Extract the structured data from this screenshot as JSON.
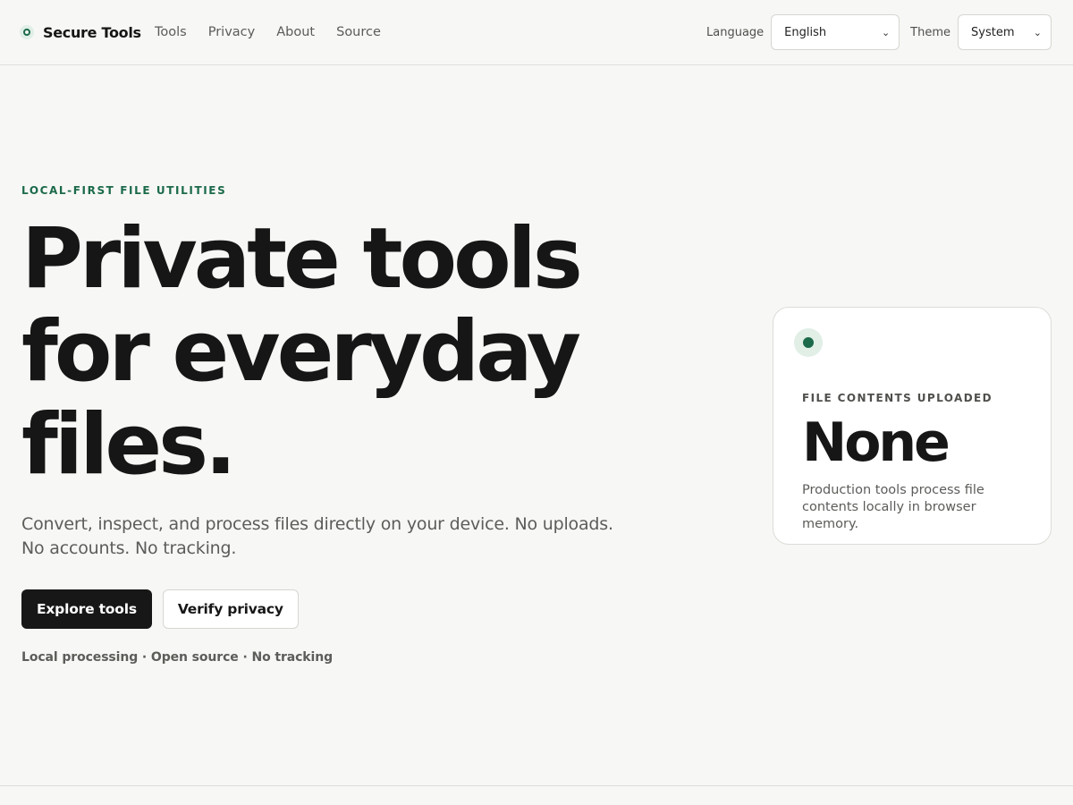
{
  "header": {
    "brand": "Secure Tools",
    "nav": [
      {
        "label": "Tools"
      },
      {
        "label": "Privacy"
      },
      {
        "label": "About"
      },
      {
        "label": "Source"
      }
    ],
    "language": {
      "label": "Language",
      "value": "English"
    },
    "theme": {
      "label": "Theme",
      "value": "System"
    }
  },
  "hero": {
    "eyebrow": "LOCAL-FIRST FILE UTILITIES",
    "title_lines": [
      "Private tools",
      "for everyday",
      "files."
    ],
    "subtitle": "Convert, inspect, and process files directly on your device. No uploads. No accounts. No tracking.",
    "primary_cta": "Explore tools",
    "secondary_cta": "Verify privacy",
    "meta": "Local processing · Open source · No tracking"
  },
  "card": {
    "icon": "status-dot-icon",
    "label": "FILE CONTENTS UPLOADED",
    "value": "None",
    "description": "Production tools process file contents locally in browser memory."
  },
  "colors": {
    "background": "#f7f7f5",
    "accent": "#1b6a4a",
    "text": "#161616",
    "muted": "#5c5c59",
    "primary_button": "#171717"
  }
}
